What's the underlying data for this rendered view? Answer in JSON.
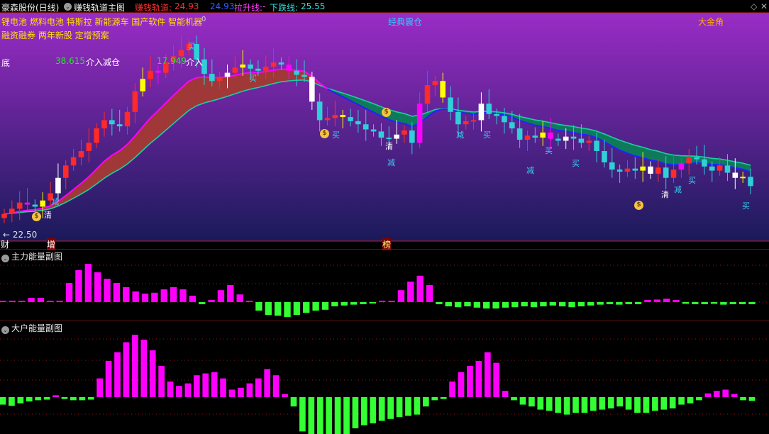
{
  "header": {
    "stock": "豪森股份(日线)",
    "indicator": "赚钱轨道主图",
    "track_label": "赚钱轨道:",
    "track_value": "24.93",
    "track_value2": "24.93",
    "rise_label": "拉升线:",
    "rise_value": "-",
    "fall_label": "下跌线:",
    "fall_value": "25.55",
    "mark_zero": "0"
  },
  "concepts": {
    "line1": "锂电池 燃料电池 特斯拉 新能源车 国产软件 智能机器",
    "line2": "融资融券 两年新股 定增预案"
  },
  "labels": {
    "classic": "经典震仓",
    "golden": "大金角",
    "bottom": "底",
    "price1": "38.615",
    "action1": "介入减仓",
    "price2": "17.949",
    "action2": "介入",
    "low_price": "22.50",
    "bottom_cai": "财",
    "bottom_zeng": "增",
    "bottom_bang": "榜"
  },
  "signals": [
    {
      "text": "买",
      "color": "#37d0f0"
    },
    {
      "text": "减",
      "color": "#37d0f0"
    },
    {
      "text": "清",
      "color": "#ffffff"
    },
    {
      "text": "买",
      "color": "#37d0f0"
    },
    {
      "text": "减",
      "color": "#37d0f0"
    },
    {
      "text": "清",
      "color": "#ffffff"
    },
    {
      "text": "买",
      "color": "#37d0f0"
    },
    {
      "text": "减",
      "color": "#37d0f0"
    },
    {
      "text": "买",
      "color": "#37d0f0"
    },
    {
      "text": "减",
      "color": "#37d0f0"
    },
    {
      "text": "买",
      "color": "#37d0f0"
    },
    {
      "text": "买",
      "color": "#37d0f0"
    },
    {
      "text": "清",
      "color": "#ffffff"
    },
    {
      "text": "减",
      "color": "#37d0f0"
    },
    {
      "text": "买",
      "color": "#37d0f0"
    },
    {
      "text": "买",
      "color": "#37d0f0"
    },
    {
      "text": "买",
      "color": "#37d0f0"
    }
  ],
  "coin_symbol": "$",
  "panels": {
    "sub1_title": "主力能量副图",
    "sub2_title": "大户能量副图"
  },
  "colors": {
    "up": "#ff2a2a",
    "down": "#2fd0d8",
    "magenta": "#ff00ff",
    "green_bar": "#33ff33",
    "band_red": "#a03838",
    "band_green": "#0f7a5a",
    "track_line": "#ff00ff",
    "blue_line": "#2222ff",
    "teal_line": "#1ad0a0",
    "bg_top": "#9a2cc6",
    "bg_bottom": "#1a1a5a"
  },
  "series": {
    "closes": [
      22.3,
      22.8,
      23.4,
      23.2,
      23.0,
      23.6,
      24.3,
      25.8,
      27.0,
      27.8,
      28.4,
      29.2,
      30.6,
      31.4,
      31.0,
      30.8,
      32.2,
      34.2,
      35.4,
      36.2,
      36.0,
      37.0,
      37.6,
      38.2,
      38.8,
      37.3,
      35.9,
      35.2,
      35.6,
      36.0,
      36.5,
      36.8,
      36.4,
      36.2,
      36.6,
      37.0,
      36.8,
      36.2,
      35.8,
      35.6,
      33.2,
      31.4,
      31.6,
      31.9,
      31.7,
      31.3,
      31.0,
      30.5,
      30.3,
      29.7,
      29.6,
      30.0,
      30.4,
      29.2,
      33.0,
      34.8,
      35.2,
      33.6,
      32.2,
      31.0,
      31.3,
      31.4,
      33.0,
      32.0,
      31.8,
      31.2,
      30.6,
      29.5,
      29.9,
      29.7,
      30.2,
      29.6,
      29.4,
      29.8,
      29.6,
      29.2,
      29.4,
      28.4,
      27.3,
      26.6,
      26.4,
      26.7,
      26.5,
      26.9,
      26.2,
      26.8,
      25.8,
      26.6,
      27.2,
      27.8,
      27.6,
      26.9,
      26.5,
      27.0,
      26.3,
      25.8,
      25.9,
      25.0
    ],
    "sub1": [
      0,
      0,
      0,
      0.1,
      0.1,
      0,
      0,
      0.45,
      0.75,
      0.9,
      0.7,
      0.55,
      0.45,
      0.35,
      0.25,
      0.2,
      0.22,
      0.3,
      0.35,
      0.3,
      0.15,
      -0.05,
      0.05,
      0.28,
      0.4,
      0.18,
      0,
      -0.2,
      -0.3,
      -0.32,
      -0.35,
      -0.3,
      -0.25,
      -0.2,
      -0.18,
      -0.1,
      -0.08,
      -0.06,
      -0.05,
      -0.02,
      0.02,
      0.02,
      0.28,
      0.48,
      0.62,
      0.4,
      -0.05,
      -0.1,
      -0.12,
      -0.1,
      -0.13,
      -0.15,
      -0.15,
      -0.13,
      -0.12,
      -0.1,
      -0.12,
      -0.1,
      -0.08,
      -0.1,
      -0.12,
      -0.1,
      -0.08,
      -0.06,
      -0.05,
      -0.06,
      -0.05,
      -0.05,
      0.05,
      0.06,
      0.08,
      0.05,
      -0.04,
      -0.05,
      -0.05,
      -0.04,
      -0.06,
      -0.05,
      -0.05,
      -0.05
    ],
    "sub2": [
      -0.12,
      -0.14,
      -0.1,
      -0.07,
      -0.05,
      -0.04,
      0.03,
      -0.03,
      -0.05,
      -0.05,
      -0.04,
      0.3,
      0.58,
      0.72,
      0.88,
      1.0,
      0.92,
      0.75,
      0.5,
      0.25,
      0.18,
      0.22,
      0.35,
      0.38,
      0.4,
      0.3,
      0.12,
      0.15,
      0.22,
      0.3,
      0.45,
      0.35,
      0.05,
      -0.15,
      -0.55,
      -0.7,
      -0.78,
      -0.8,
      -0.75,
      -0.6,
      -0.5,
      -0.45,
      -0.42,
      -0.38,
      -0.35,
      -0.32,
      -0.3,
      -0.28,
      -0.15,
      -0.05,
      -0.03,
      0.25,
      0.4,
      0.5,
      0.58,
      0.72,
      0.55,
      0.1,
      -0.05,
      -0.12,
      -0.15,
      -0.2,
      -0.22,
      -0.25,
      -0.28,
      -0.25,
      -0.25,
      -0.22,
      -0.2,
      -0.18,
      -0.15,
      -0.2,
      -0.25,
      -0.25,
      -0.22,
      -0.2,
      -0.18,
      -0.12,
      -0.1,
      -0.05,
      0.06,
      0.1,
      0.12,
      0.05,
      -0.05,
      -0.06
    ]
  }
}
